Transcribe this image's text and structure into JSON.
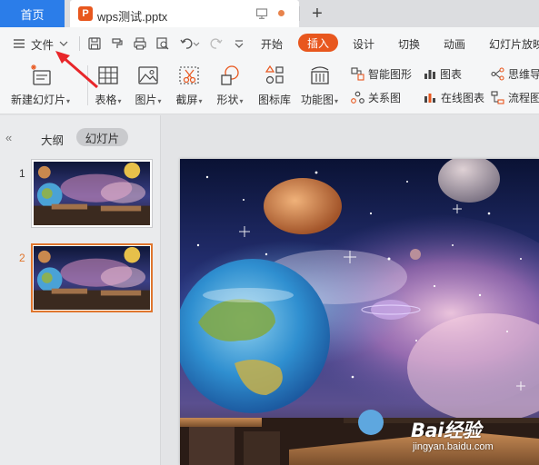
{
  "tabs": {
    "home_label": "首页",
    "doc_icon_letter": "P",
    "doc_title": "wps测试.pptx",
    "new_tab_label": "+"
  },
  "menu": {
    "file_label": "文件",
    "ribbon_tabs": [
      "开始",
      "插入",
      "设计",
      "切换",
      "动画",
      "幻灯片放映"
    ]
  },
  "ribbon": {
    "new_slide": "新建幻灯片",
    "table": "表格",
    "picture": "图片",
    "screenshot": "截屏",
    "shape": "形状",
    "icon_library": "图标库",
    "function_chart": "功能图",
    "smart_graphic": "智能图形",
    "chart": "图表",
    "relationship": "关系图",
    "online_chart": "在线图表",
    "mind_map": "思维导",
    "flowchart": "流程图"
  },
  "panel": {
    "collapse_glyph": "«",
    "outline_tab": "大纲",
    "slides_tab": "幻灯片",
    "slides": [
      {
        "number": "1",
        "selected": false
      },
      {
        "number": "2",
        "selected": true
      }
    ]
  },
  "watermark": {
    "brand": "Bai经验",
    "url": "jingyan.baidu.com"
  },
  "colors": {
    "accent_blue": "#2b7de9",
    "accent_orange": "#e8571e",
    "selection_border": "#e0762e",
    "annotation_arrow": "#e8262a"
  }
}
